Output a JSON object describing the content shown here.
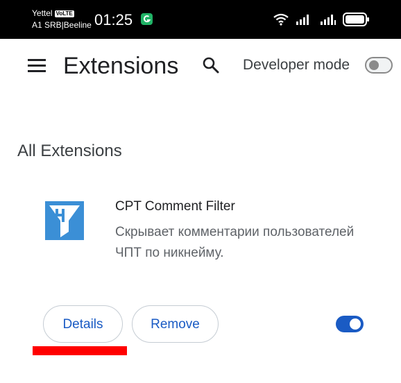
{
  "status_bar": {
    "carrier_line1": "Yettel",
    "carrier_line1_badge": "VoLTE",
    "carrier_line2": "A1 SRB|Beeline",
    "time": "01:25",
    "app_badge_icon": "app-notification-icon",
    "icons": [
      "wifi-icon",
      "signal-icon",
      "signal-icon",
      "battery-icon"
    ]
  },
  "toolbar": {
    "menu_icon": "menu-icon",
    "title": "Extensions",
    "search_icon": "search-icon",
    "developer_mode_label": "Developer mode",
    "developer_mode_enabled": false
  },
  "section": {
    "title": "All Extensions"
  },
  "extension": {
    "icon": "funnel-icon",
    "name": "CPT Comment Filter",
    "description": "Скрывает комментарии пользователей ЧПТ по никнейму.",
    "details_label": "Details",
    "remove_label": "Remove",
    "enabled": true
  },
  "colors": {
    "accent": "#1a5bc4",
    "highlight": "#ff0000",
    "status_bar_bg": "#000000",
    "extension_icon_bg": "#3b8fd6"
  }
}
